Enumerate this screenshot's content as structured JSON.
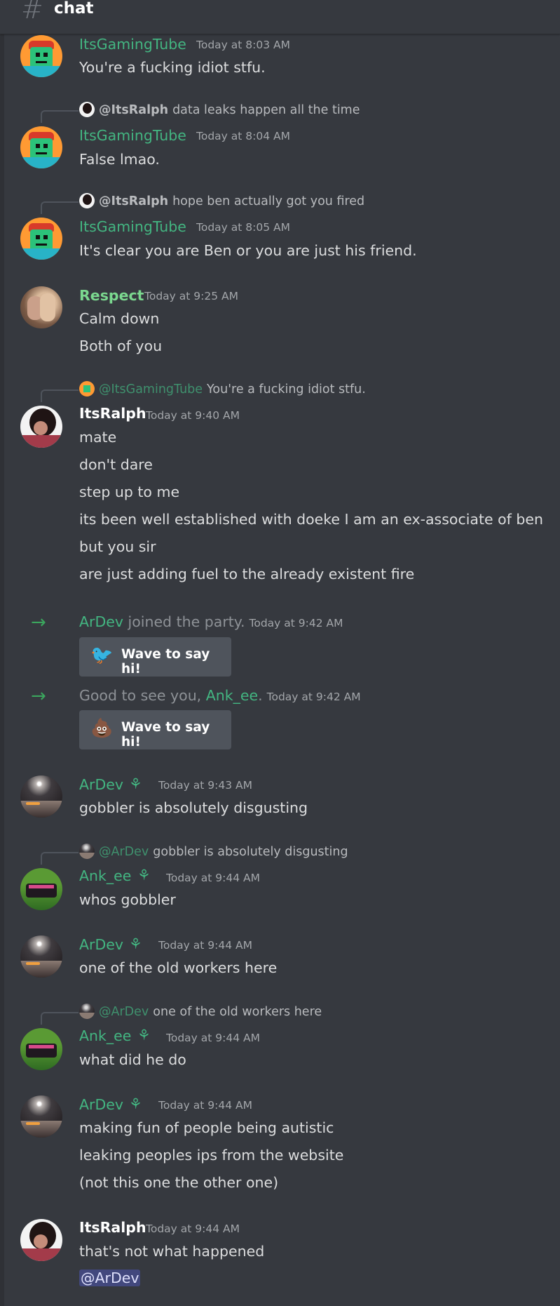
{
  "channel": {
    "name": "chat"
  },
  "messages": {
    "m1": {
      "author": "ItsGamingTube",
      "time": "Today at 8:03 AM",
      "lines": [
        "You're a fucking idiot stfu."
      ]
    },
    "m2": {
      "reply_user": "@ItsRalph",
      "reply_text": "data leaks happen all the time",
      "author": "ItsGamingTube",
      "time": "Today at 8:04 AM",
      "lines": [
        "False lmao."
      ]
    },
    "m3": {
      "reply_user": "@ItsRalph",
      "reply_text": "hope ben actually got you fired",
      "author": "ItsGamingTube",
      "time": "Today at 8:05 AM",
      "lines": [
        "It's clear you are Ben or you are just his friend."
      ]
    },
    "m4": {
      "author": "Respect",
      "time": "Today at 9:25 AM",
      "lines": [
        "Calm down",
        "Both of you"
      ]
    },
    "m5": {
      "reply_user": "@ItsGamingTube",
      "reply_text": "You're a fucking idiot stfu.",
      "author": "ItsRalph",
      "time": "Today at 9:40 AM",
      "lines": [
        "mate",
        "don't dare",
        "step up to me",
        "its been well established with doeke I am an ex-associate of ben",
        "but you sir",
        "are just adding fuel to the already existent fire"
      ]
    },
    "s1": {
      "user": "ArDev",
      "text": "joined the party.",
      "time": "Today at 9:42 AM",
      "wave": "Wave to say hi!"
    },
    "s2": {
      "prefix": "Good to see you,",
      "user": "Ank_ee",
      "suffix": ".",
      "time": "Today at 9:42 AM",
      "wave": "Wave to say hi!"
    },
    "m6": {
      "author": "ArDev",
      "time": "Today at 9:43 AM",
      "lines": [
        "gobbler is absolutely disgusting"
      ]
    },
    "m7": {
      "reply_user": "@ArDev",
      "reply_text": "gobbler is absolutely disgusting",
      "author": "Ank_ee",
      "time": "Today at 9:44 AM",
      "lines": [
        "whos gobbler"
      ]
    },
    "m8": {
      "author": "ArDev",
      "time": "Today at 9:44 AM",
      "lines": [
        "one of the old workers here"
      ]
    },
    "m9": {
      "reply_user": "@ArDev",
      "reply_text": "one of the old workers here",
      "author": "Ank_ee",
      "time": "Today at 9:44 AM",
      "lines": [
        "what did he do"
      ]
    },
    "m10": {
      "author": "ArDev",
      "time": "Today at 9:44 AM",
      "lines": [
        "making fun of people being autistic",
        "leaking peoples ips from the website",
        "(not this one the other one)"
      ]
    },
    "m11": {
      "author": "ItsRalph",
      "time": "Today at 9:44 AM",
      "lines": [
        "that's not what happened"
      ],
      "mention": "@ArDev"
    }
  },
  "icons": {
    "hash": "hash-icon",
    "join": "arrow-right-icon",
    "badge": "sprout-icon",
    "wave_sticker": "sticker-icon"
  },
  "colors": {
    "background": "#36393f",
    "username_green": "#43b581",
    "username_light_green": "#7bd88f",
    "timestamp": "#a3a6aa",
    "join_arrow": "#3ba55d"
  }
}
